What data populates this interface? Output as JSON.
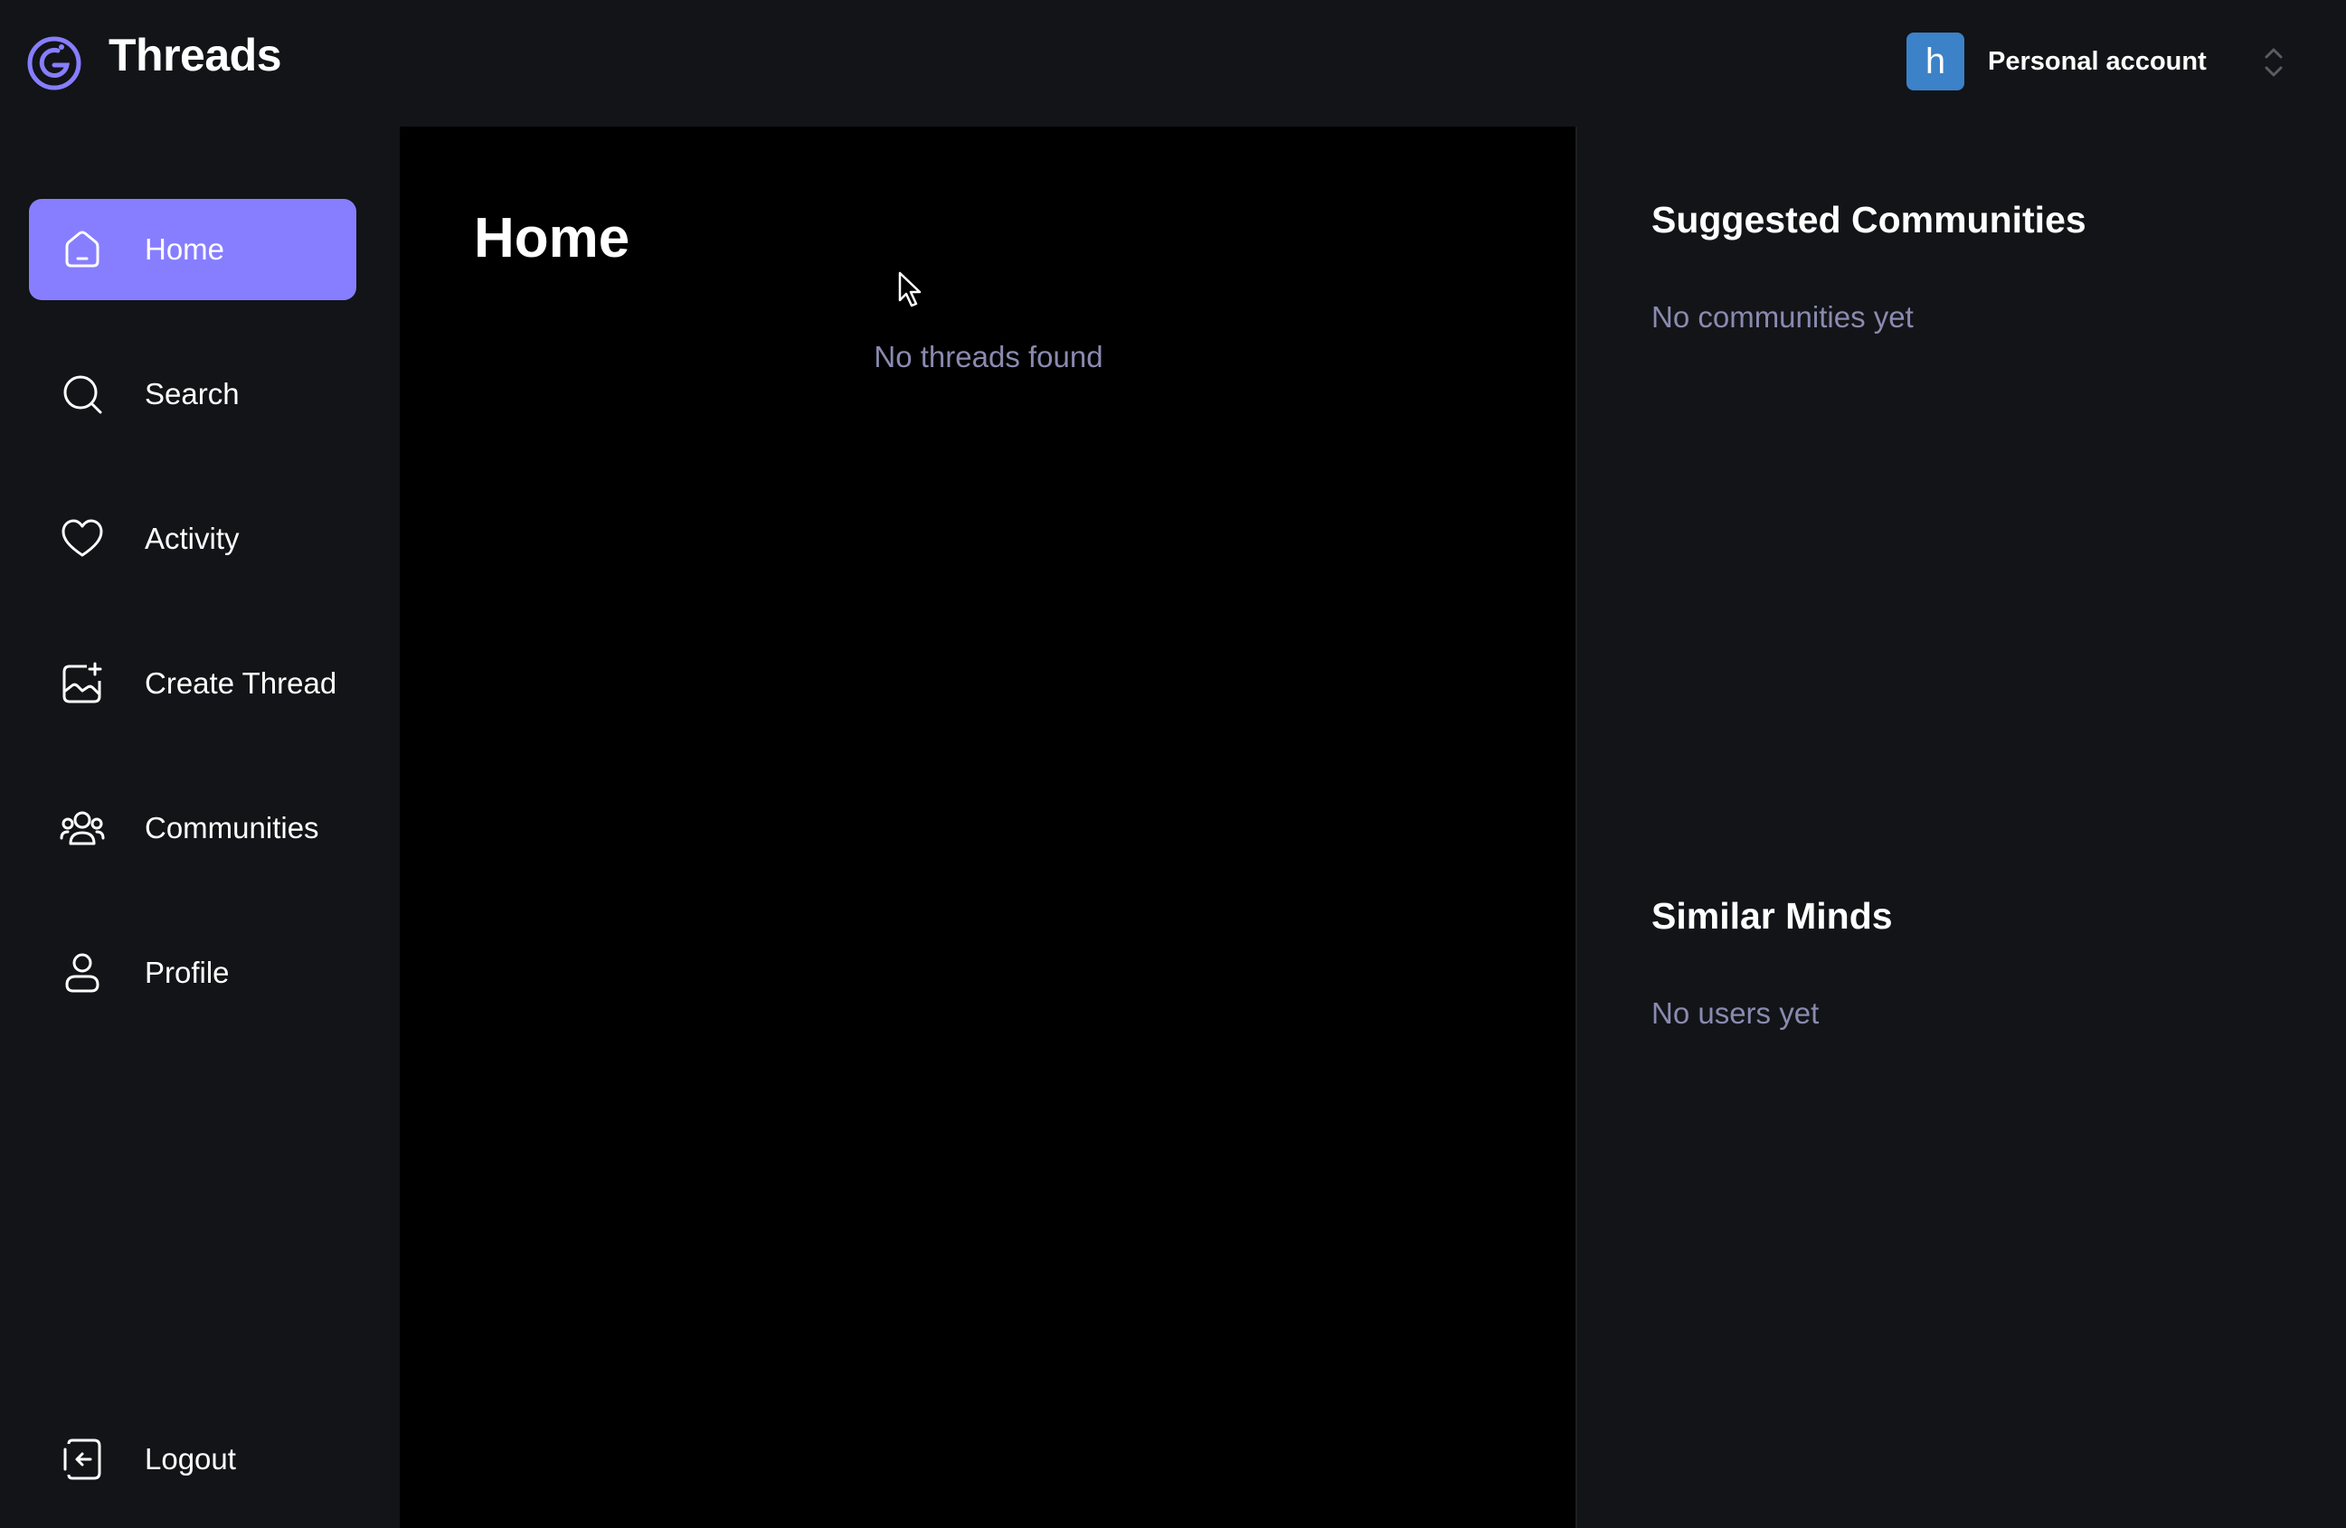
{
  "header": {
    "app_title": "Threads",
    "logo_icon": "threads-logo-icon",
    "account": {
      "avatar_initial": "h",
      "label": "Personal account",
      "switch_icon": "chevron-up-down-icon"
    }
  },
  "sidebar": {
    "items": [
      {
        "label": "Home",
        "icon": "home-icon",
        "active": true
      },
      {
        "label": "Search",
        "icon": "search-icon",
        "active": false
      },
      {
        "label": "Activity",
        "icon": "heart-icon",
        "active": false
      },
      {
        "label": "Create Thread",
        "icon": "image-plus-icon",
        "active": false
      },
      {
        "label": "Communities",
        "icon": "users-icon",
        "active": false
      },
      {
        "label": "Profile",
        "icon": "user-icon",
        "active": false
      }
    ],
    "logout_label": "Logout",
    "logout_icon": "logout-icon"
  },
  "main": {
    "title": "Home",
    "empty_message": "No threads found"
  },
  "rightbar": {
    "suggested_communities": {
      "title": "Suggested Communities",
      "empty_message": "No communities yet"
    },
    "similar_minds": {
      "title": "Similar Minds",
      "empty_message": "No users yet"
    }
  },
  "colors": {
    "accent": "#877eff",
    "background": "#121417",
    "main_background": "#000000",
    "muted_text": "#8a8ab0",
    "avatar": "#3b82c8"
  }
}
